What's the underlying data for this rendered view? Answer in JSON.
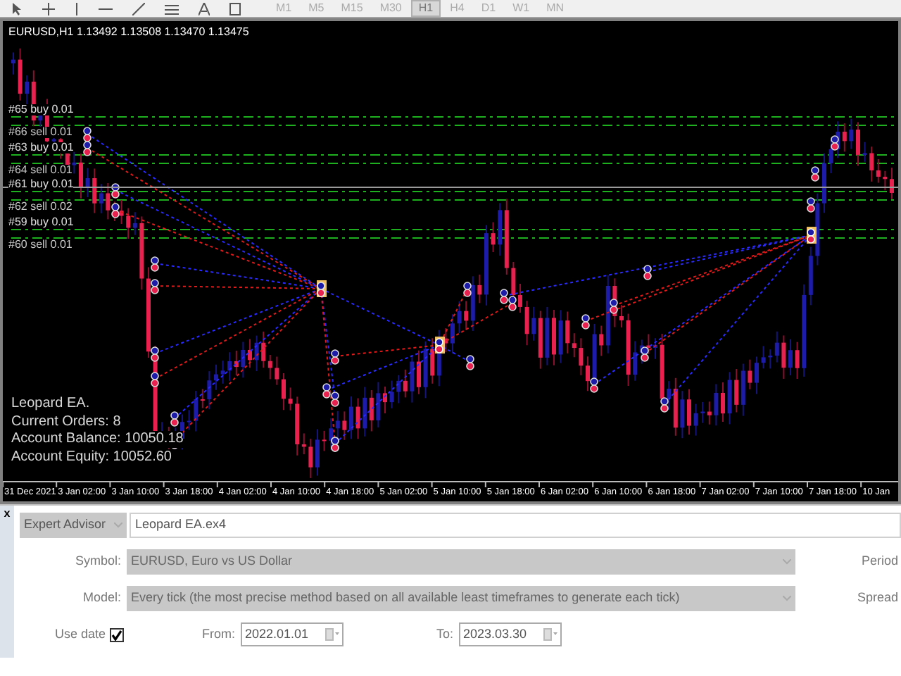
{
  "toolbar": {
    "timeframes": [
      {
        "label": "M1",
        "selected": false
      },
      {
        "label": "M5",
        "selected": false
      },
      {
        "label": "M15",
        "selected": false
      },
      {
        "label": "M30",
        "selected": false
      },
      {
        "label": "H1",
        "selected": true
      },
      {
        "label": "H4",
        "selected": false
      },
      {
        "label": "D1",
        "selected": false
      },
      {
        "label": "W1",
        "selected": false
      },
      {
        "label": "MN",
        "selected": false
      }
    ]
  },
  "chart": {
    "title": "EURUSD,H1  1.13492 1.13508 1.13470 1.13475",
    "order_lines": [
      {
        "label": "#65 buy 0.01",
        "kind": "buy"
      },
      {
        "label": "#66 sell 0.01",
        "kind": "sell"
      },
      {
        "label": "#63 buy 0.01",
        "kind": "buy"
      },
      {
        "label": "#64 sell 0.01",
        "kind": "sell"
      },
      {
        "label": "#61 buy 0.01",
        "kind": "buy"
      },
      {
        "label": "#62 sell 0.02",
        "kind": "sell"
      },
      {
        "label": "#59 buy 0.01",
        "kind": "buy"
      },
      {
        "label": "#60 sell 0.01",
        "kind": "sell"
      }
    ],
    "info": [
      "Leopard EA.",
      "Current Orders:  8",
      "Account Balance: 10050.18",
      "Account Equity: 10052.60"
    ],
    "time_axis": [
      "31 Dec 2021",
      "3 Jan 02:00",
      "3 Jan 10:00",
      "3 Jan 18:00",
      "4 Jan 02:00",
      "4 Jan 10:00",
      "4 Jan 18:00",
      "5 Jan 02:00",
      "5 Jan 10:00",
      "5 Jan 18:00",
      "6 Jan 02:00",
      "6 Jan 10:00",
      "6 Jan 18:00",
      "7 Jan 02:00",
      "7 Jan 10:00",
      "7 Jan 18:00",
      "10 Jan"
    ]
  },
  "tester": {
    "close": "x",
    "expert": {
      "label": "Expert Advisor",
      "value": "Leopard EA.ex4"
    },
    "symbol": {
      "label": "Symbol:",
      "value": "EURUSD, Euro vs US Dollar"
    },
    "period_label": "Period",
    "model": {
      "label": "Model:",
      "value": "Every tick (the most precise method based on all available least timeframes to generate each tick)"
    },
    "spread_label": "Spread",
    "use_date": {
      "label": "Use date",
      "checked": true
    },
    "from": {
      "label": "From:",
      "value": "2022.01.01"
    },
    "to": {
      "label": "To:",
      "value": "2023.03.30"
    }
  }
}
